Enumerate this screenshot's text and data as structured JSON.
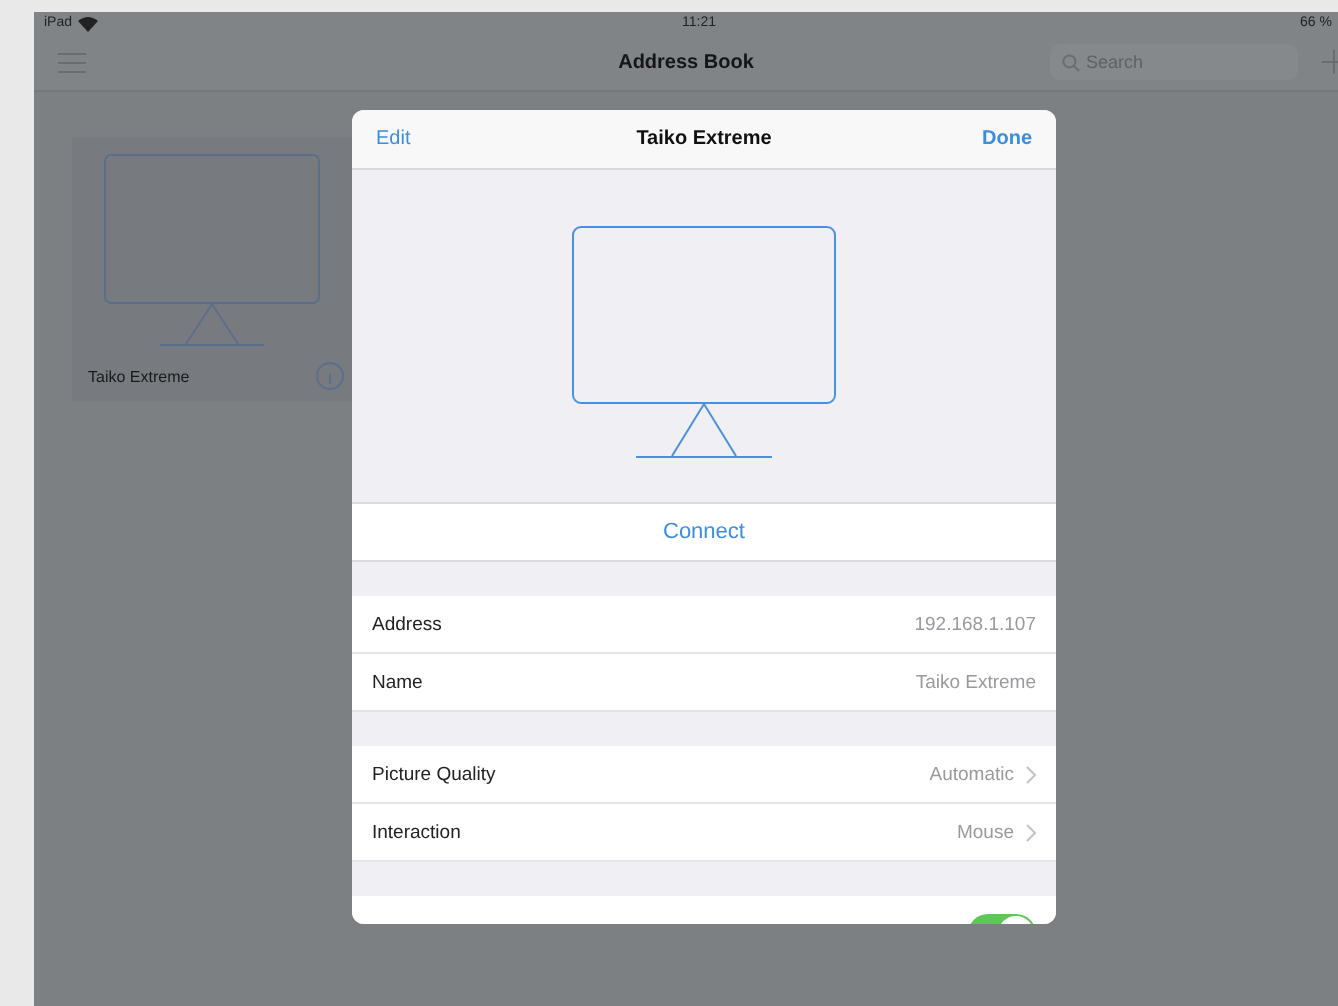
{
  "status_bar": {
    "carrier": "iPad",
    "time": "11:21",
    "battery": "66 %"
  },
  "nav_bar": {
    "title": "Address Book",
    "search": {
      "placeholder": "Search"
    }
  },
  "devices": [
    {
      "name": "Taiko Extreme"
    }
  ],
  "sheet": {
    "left_button": "Edit",
    "title": "Taiko Extreme",
    "right_button": "Done",
    "connect": "Connect",
    "sections": [
      {
        "rows": [
          {
            "kind": "value",
            "label": "Address",
            "value": "192.168.1.107"
          },
          {
            "kind": "value",
            "label": "Name",
            "value": "Taiko Extreme"
          }
        ]
      },
      {
        "rows": [
          {
            "kind": "link",
            "label": "Picture Quality",
            "value": "Automatic"
          },
          {
            "kind": "link",
            "label": "Interaction",
            "value": "Mouse"
          }
        ]
      },
      {
        "rows": [
          {
            "kind": "toggle",
            "on": true
          }
        ]
      }
    ]
  }
}
